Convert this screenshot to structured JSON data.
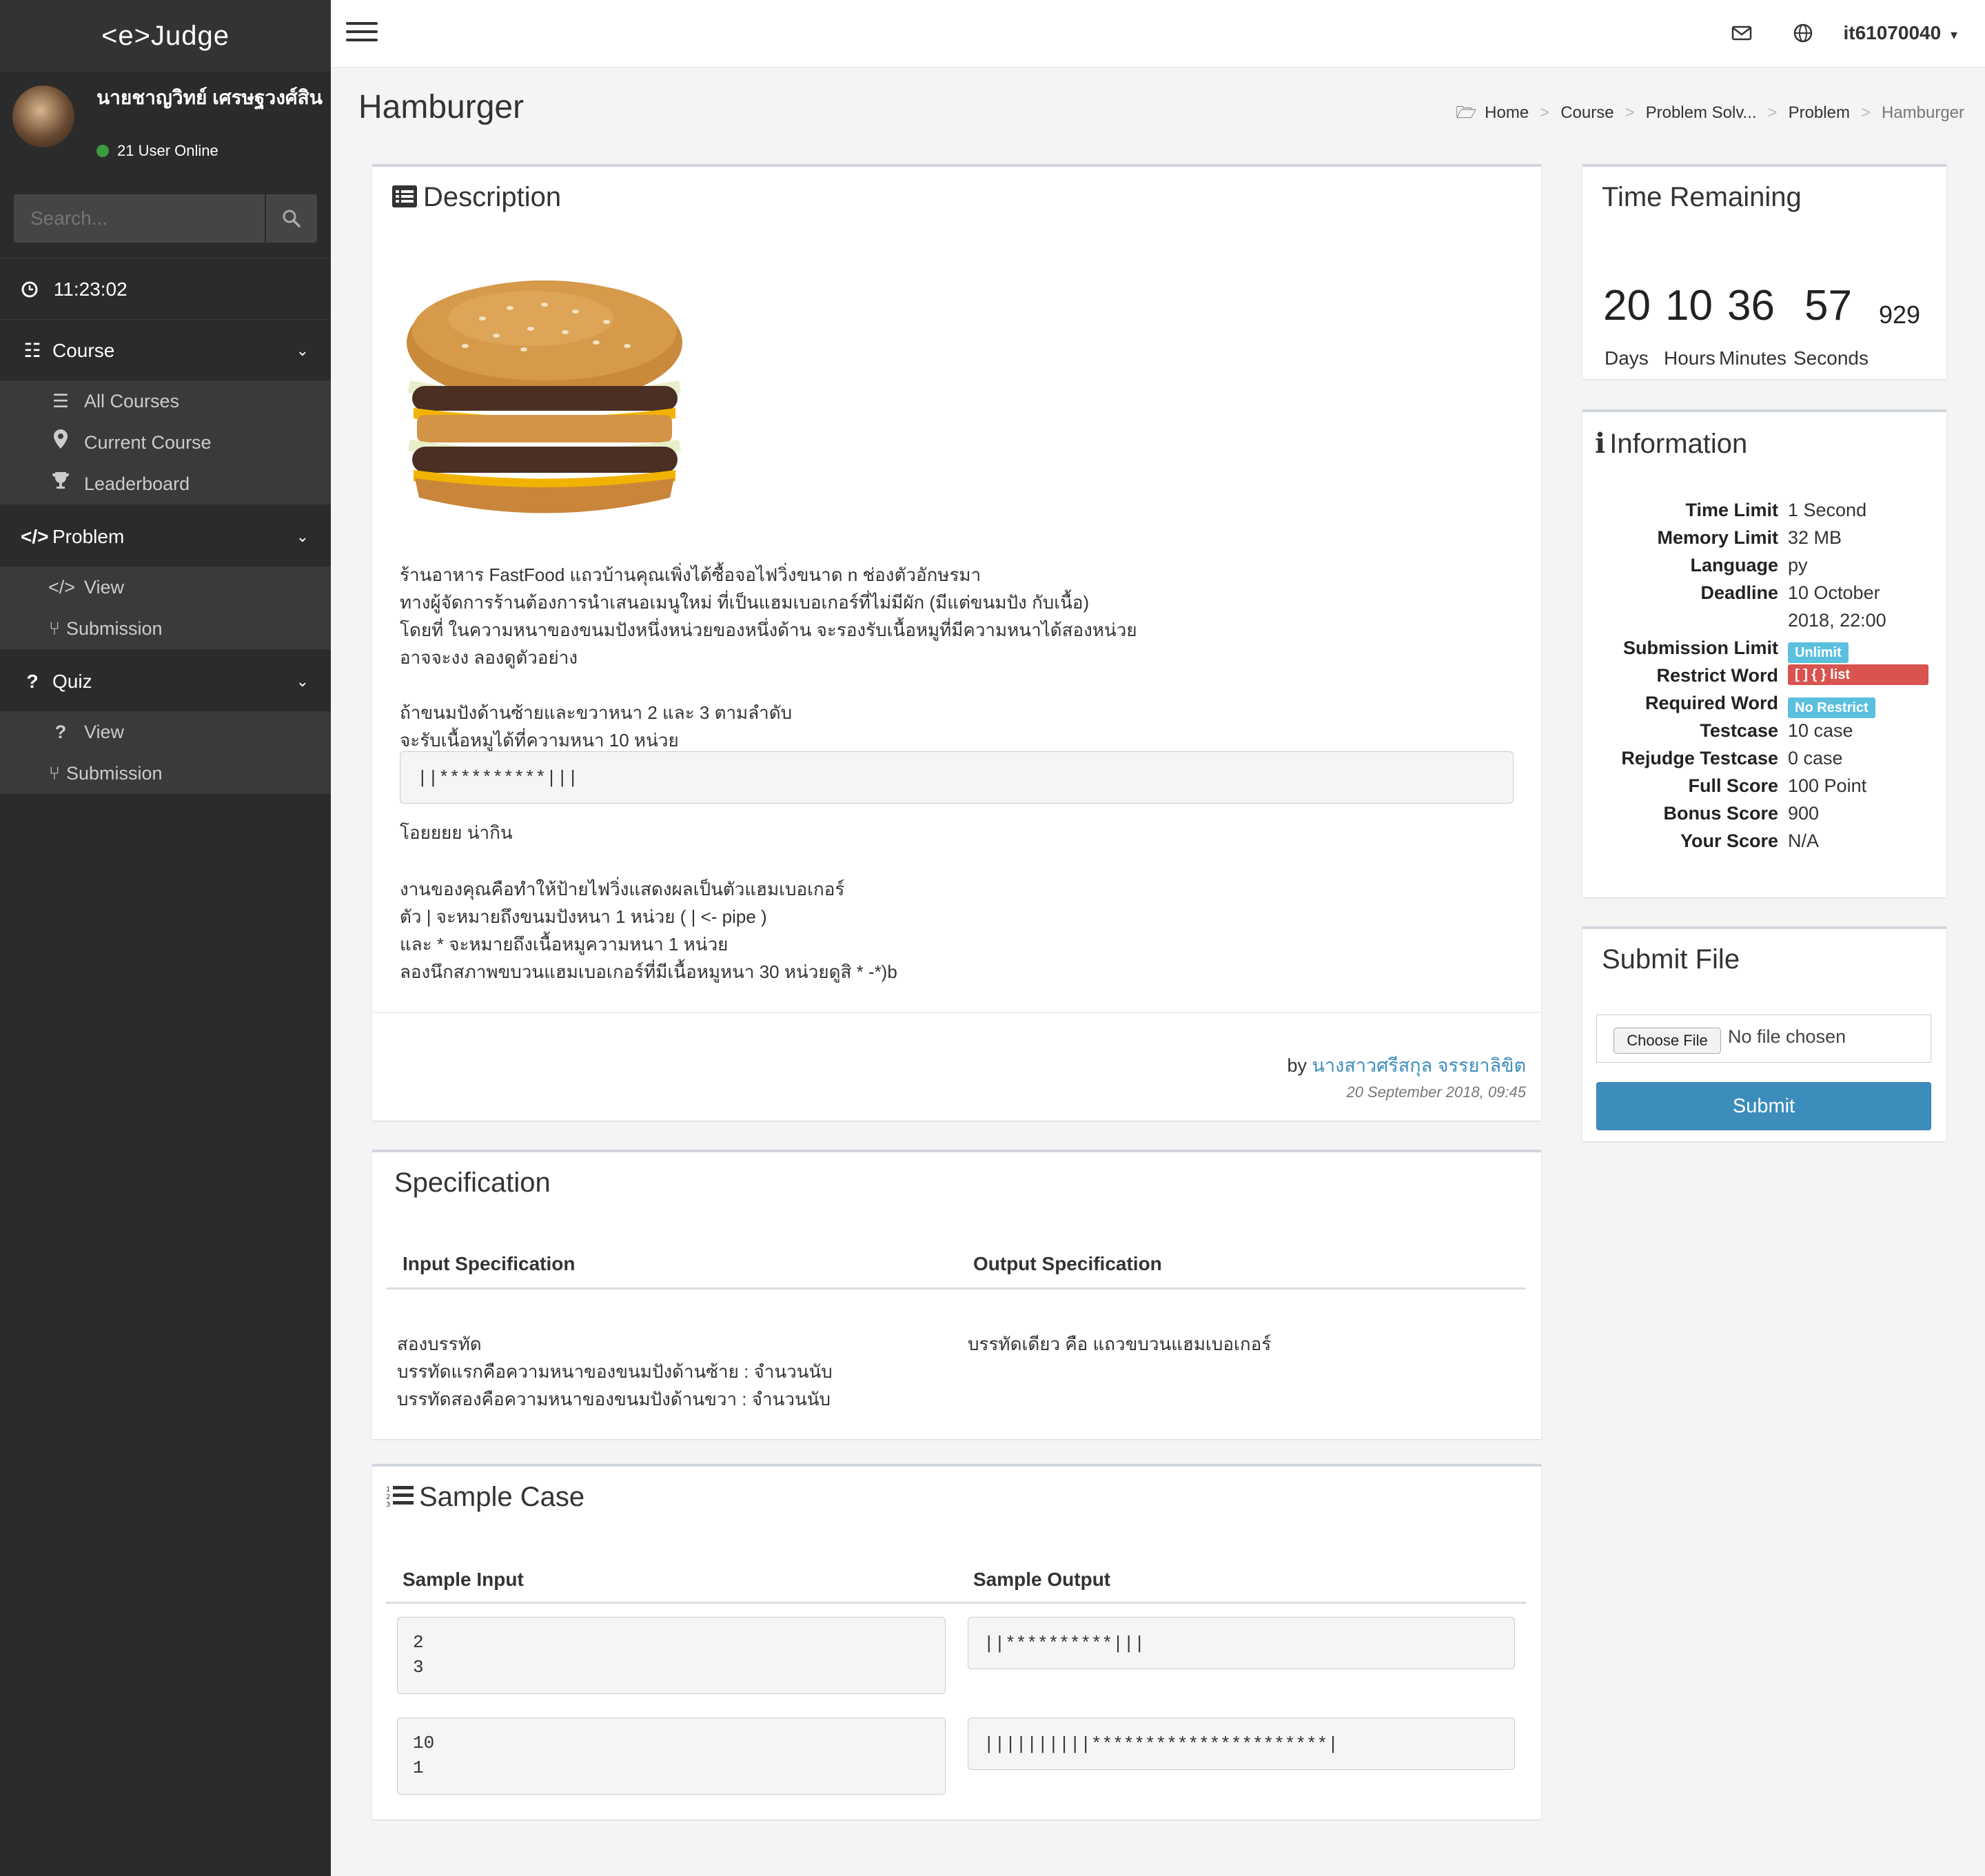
{
  "app": {
    "logo": "<e>Judge"
  },
  "user": {
    "name": "นายชาญวิทย์ เศรษฐวงศ์สิน",
    "online_text": "21 User Online",
    "account": "it61070040"
  },
  "search": {
    "placeholder": "Search..."
  },
  "clock": "11:23:02",
  "menu": {
    "course": {
      "label": "Course",
      "items": [
        {
          "label": "All Courses"
        },
        {
          "label": "Current Course"
        },
        {
          "label": "Leaderboard"
        }
      ]
    },
    "problem": {
      "label": "Problem",
      "items": [
        {
          "label": "View"
        },
        {
          "label": "Submission"
        }
      ]
    },
    "quiz": {
      "label": "Quiz",
      "items": [
        {
          "label": "View"
        },
        {
          "label": "Submission"
        }
      ]
    }
  },
  "page": {
    "title": "Hamburger"
  },
  "breadcrumb": [
    "Home",
    "Course",
    "Problem Solv...",
    "Problem",
    "Hamburger"
  ],
  "description": {
    "title": "Description",
    "para1": [
      "ร้านอาหาร FastFood แถวบ้านคุณเพิ่งได้ซื้อจอไฟวิ่งขนาด n ช่องตัวอักษรมา",
      "ทางผู้จัดการร้านต้องการนำเสนอเมนูใหม่ ที่เป็นแฮมเบอเกอร์ที่ไม่มีผัก (มีแต่ขนมปัง กับเนื้อ)",
      "โดยที่ ในความหนาของขนมปังหนึ่งหน่วยของหนึ่งด้าน จะรองรับเนื้อหมูที่มีความหนาได้สองหน่วย",
      "อาจจะงง ลองดูตัวอย่าง"
    ],
    "para2": [
      "ถ้าขนมปังด้านซ้ายและขวาหนา 2 และ 3 ตามลำดับ",
      "จะรับเนื้อหมูได้ที่ความหนา 10 หน่วย"
    ],
    "code": "||**********|||",
    "para3": "โอยยยย น่ากิน",
    "para4": [
      "งานของคุณคือทำให้ป้ายไฟวิ่งแสดงผลเป็นตัวแฮมเบอเกอร์",
      "ตัว | จะหมายถึงขนมปังหนา 1 หน่วย ( | <- pipe )",
      "และ * จะหมายถึงเนื้อหมูความหนา 1 หน่วย"
    ],
    "para5": "ลองนึกสภาพขบวนแฮมเบอเกอร์ที่มีเนื้อหมูหนา 30 หน่วยดูสิ * -*)b",
    "by_prefix": "by",
    "author": "นางสาวศรีสกุล จรรยาลิขิต",
    "date": "20 September 2018, 09:45"
  },
  "specification": {
    "title": "Specification",
    "input_header": "Input Specification",
    "output_header": "Output Specification",
    "input_lines": [
      "สองบรรทัด",
      "บรรทัดแรกคือความหนาของขนมปังด้านซ้าย : จำนวนนับ",
      "บรรทัดสองคือความหนาของขนมปังด้านขวา : จำนวนนับ"
    ],
    "output_lines": [
      "บรรทัดเดียว คือ แถวขบวนแฮมเบอเกอร์"
    ]
  },
  "sample": {
    "title": "Sample Case",
    "input_header": "Sample Input",
    "output_header": "Sample Output",
    "cases": [
      {
        "input": [
          "2",
          "3"
        ],
        "output": "||**********|||"
      },
      {
        "input": [
          "10",
          "1"
        ],
        "output": "||||||||||**********************|"
      }
    ]
  },
  "time_remaining": {
    "title": "Time Remaining",
    "days": "20",
    "hours": "10",
    "minutes": "36",
    "seconds": "57",
    "ms": "929",
    "labels": {
      "days": "Days",
      "hours": "Hours",
      "minutes": "Minutes",
      "seconds": "Seconds"
    }
  },
  "information": {
    "title": "Information",
    "rows": [
      {
        "key": "Time Limit",
        "value": "1 Second"
      },
      {
        "key": "Memory Limit",
        "value": "32 MB"
      },
      {
        "key": "Language",
        "value": "py"
      },
      {
        "key": "Deadline",
        "value": "10 October",
        "value2": "2018, 22:00"
      },
      {
        "key": "Submission Limit",
        "badge": "Unlimit"
      },
      {
        "key": "Restrict Word",
        "badge": "[ ] { } list"
      },
      {
        "key": "Required Word",
        "badge": "No Restrict"
      },
      {
        "key": "Testcase",
        "value": "10 case"
      },
      {
        "key": "Rejudge Testcase",
        "value": "0 case"
      },
      {
        "key": "Full Score",
        "value": "100 Point"
      },
      {
        "key": "Bonus Score",
        "value": "900"
      },
      {
        "key": "Your Score",
        "value": "N/A"
      }
    ]
  },
  "submit": {
    "title": "Submit File",
    "choose_label": "Choose File",
    "no_file": "No file chosen",
    "button": "Submit"
  },
  "colors": {
    "sidebar": "#2b2b2b",
    "primary": "#3c8dbc",
    "info_badge": "#5bc0de",
    "danger_badge": "#d9534f"
  }
}
